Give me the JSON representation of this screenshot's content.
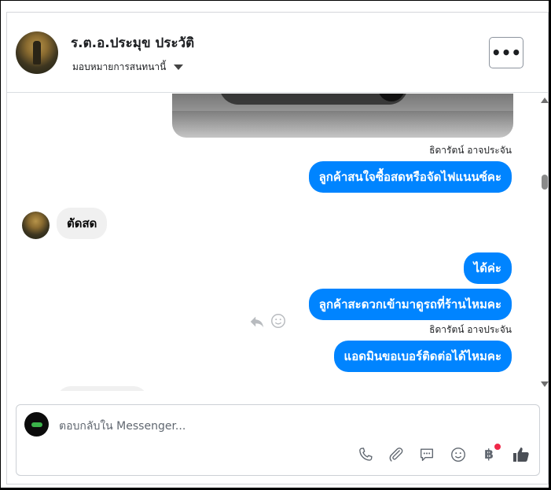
{
  "header": {
    "contact_name": "ร.ต.อ.ประมุข ประวัติ",
    "assign_label": "มอบหมายการสนทนานี้",
    "more_label": "•••"
  },
  "messages": [
    {
      "type": "image",
      "direction": "outgoing"
    },
    {
      "type": "sender",
      "text": "ธิดารัตน์ อาจประจัน"
    },
    {
      "type": "outgoing",
      "text": "ลูกค้าสนใจซื้อสดหรือจัดไฟแนนซ์คะ"
    },
    {
      "type": "incoming",
      "text": "ตัดสด"
    },
    {
      "type": "outgoing",
      "text": "ได้ค่ะ"
    },
    {
      "type": "outgoing",
      "text": "ลูกค้าสะดวกเข้ามาดูรถที่ร้านไหมคะ"
    },
    {
      "type": "sender",
      "text": "ธิดารัตน์ อาจประจัน"
    },
    {
      "type": "outgoing",
      "text": "แอดมินขอเบอร์ติดต่อได้ไหมคะ"
    }
  ],
  "composer": {
    "placeholder": "ตอบกลับใน Messenger...",
    "tools": [
      "phone-icon",
      "attach-icon",
      "comment-icon",
      "emoji-icon",
      "baht-icon",
      "like-icon"
    ],
    "baht_symbol": "฿"
  },
  "colors": {
    "outgoing_bubble": "#0084ff",
    "incoming_bubble": "#f0f0f0",
    "notification_dot": "#f02849"
  }
}
